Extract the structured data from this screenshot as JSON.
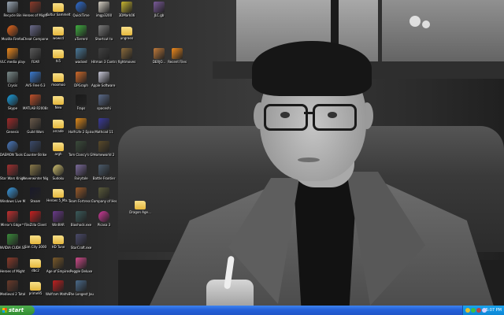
{
  "desktop": {
    "icons": [
      {
        "label": "Recycle Bin",
        "icon": "recycle-bin-icon",
        "color": "#9aa7b4",
        "shape": "sq"
      },
      {
        "label": "Heroes of Might and...",
        "icon": "game-icon",
        "color": "#8a3a2a",
        "shape": "sq"
      },
      {
        "label": "Kultur Sammelt",
        "icon": "folder-icon",
        "color": "",
        "shape": "folder"
      },
      {
        "label": "QuickTime",
        "icon": "quicktime-icon",
        "color": "#2f6fd6",
        "shape": "round"
      },
      {
        "label": "imgp3200",
        "icon": "image-file-icon",
        "color": "#d6d0c4",
        "shape": "sq"
      },
      {
        "label": "3DMark06",
        "icon": "benchmark-icon",
        "color": "#c8b530",
        "shape": "sq"
      },
      {
        "label": "Mozilla Firefox",
        "icon": "firefox-icon",
        "color": "#e8671c",
        "shape": "round"
      },
      {
        "label": "Cheat Component",
        "icon": "component-icon",
        "color": "#6a6a8a",
        "shape": "sq"
      },
      {
        "label": "wowcd",
        "icon": "folder-icon",
        "color": "",
        "shape": "folder"
      },
      {
        "label": "uTorrent",
        "icon": "utorrent-icon",
        "color": "#3fae3f",
        "shape": "sq"
      },
      {
        "label": "Shortcut to",
        "icon": "shortcut-icon",
        "color": "#7a7a7a",
        "shape": "sq"
      },
      {
        "label": "ungreen",
        "icon": "folder-icon",
        "color": "",
        "shape": "folder"
      },
      {
        "label": "VLC media player",
        "icon": "vlc-icon",
        "color": "#f08a1c",
        "shape": "sq"
      },
      {
        "label": "FEAR",
        "icon": "game-icon",
        "color": "#5a5a5a",
        "shape": "sq"
      },
      {
        "label": "hi5",
        "icon": "folder-icon",
        "color": "",
        "shape": "folder"
      },
      {
        "label": "wacked",
        "icon": "app-icon",
        "color": "#4a7a9a",
        "shape": "sq"
      },
      {
        "label": "Hitman 3 Contracts",
        "icon": "game-icon",
        "color": "#404040",
        "shape": "sq"
      },
      {
        "label": "fightmoves",
        "icon": "game-icon",
        "color": "#8a6a3a",
        "shape": "sq"
      },
      {
        "label": "Crysis",
        "icon": "crysis-icon",
        "color": "#7a8a8a",
        "shape": "sq"
      },
      {
        "label": "AVS Free 6.3",
        "icon": "avs-icon",
        "color": "#3a7ad0",
        "shape": "sq"
      },
      {
        "label": "moomoo",
        "icon": "folder-icon",
        "color": "",
        "shape": "folder"
      },
      {
        "label": "DPGraph",
        "icon": "graph-icon",
        "color": "#d06a2a",
        "shape": "sq"
      },
      {
        "label": "Apple Software Up",
        "icon": "apple-update-icon",
        "color": "#c8c8d8",
        "shape": "sq"
      },
      {
        "label": "Skype",
        "icon": "skype-icon",
        "color": "#1aa0e0",
        "shape": "round"
      },
      {
        "label": "MATLAB R2008a",
        "icon": "matlab-icon",
        "color": "#c0502a",
        "shape": "sq"
      },
      {
        "label": "New",
        "icon": "folder-icon",
        "color": "",
        "shape": "folder"
      },
      {
        "label": "Fraps",
        "icon": "fraps-icon",
        "color": "#1a1a1a",
        "shape": "sq"
      },
      {
        "label": "spaceshi",
        "icon": "app-icon",
        "color": "#5a6a8a",
        "shape": "sq"
      },
      {
        "label": "Genesis",
        "icon": "game-icon",
        "color": "#a02a2a",
        "shape": "sq"
      },
      {
        "label": "Guild Wars",
        "icon": "game-icon",
        "color": "#6a5a4a",
        "shape": "sq"
      },
      {
        "label": "arcade",
        "icon": "folder-icon",
        "color": "",
        "shape": "folder"
      },
      {
        "label": "Half-Life 2 Episode One",
        "icon": "half-life-icon",
        "color": "#e08a1a",
        "shape": "sq"
      },
      {
        "label": "Mathcad 11",
        "icon": "mathcad-icon",
        "color": "#3a3a9a",
        "shape": "sq"
      },
      {
        "label": "DAEMON Tools Lite",
        "icon": "daemon-tools-icon",
        "color": "#4a7ac0",
        "shape": "round"
      },
      {
        "label": "Counter-Strike",
        "icon": "counter-strike-icon",
        "color": "#3a4a6a",
        "shape": "sq"
      },
      {
        "label": "argh",
        "icon": "folder-icon",
        "color": "",
        "shape": "folder"
      },
      {
        "label": "Tom Clancy's Ghost Recon",
        "icon": "game-icon",
        "color": "#3a4a3a",
        "shape": "sq"
      },
      {
        "label": "Homeworld 2",
        "icon": "game-icon",
        "color": "#5a4a2a",
        "shape": "sq"
      },
      {
        "label": "Star Wars Knights of t...",
        "icon": "star-wars-icon",
        "color": "#a03030",
        "shape": "sq"
      },
      {
        "label": "Neverwinter Nights 2",
        "icon": "game-icon",
        "color": "#8a7a4a",
        "shape": "sq"
      },
      {
        "label": "Sudoku",
        "icon": "sudoku-icon",
        "color": "#d0c070",
        "shape": "round"
      },
      {
        "label": "Fairytale",
        "icon": "game-icon",
        "color": "#7a6a9a",
        "shape": "sq"
      },
      {
        "label": "Battle Frontier",
        "icon": "game-icon",
        "color": "#4a5a6a",
        "shape": "sq"
      },
      {
        "label": "Windows Live Messenger",
        "icon": "messenger-icon",
        "color": "#3a9ae0",
        "shape": "round"
      },
      {
        "label": "Steam",
        "icon": "steam-icon",
        "color": "#1a1a2a",
        "shape": "sq"
      },
      {
        "label": "Heroes 5_Ma...",
        "icon": "folder-icon",
        "color": "",
        "shape": "folder"
      },
      {
        "label": "Team Fortress 2",
        "icon": "team-fortress-icon",
        "color": "#9a5a2a",
        "shape": "sq"
      },
      {
        "label": "Company of Heroes",
        "icon": "game-icon",
        "color": "#5a5a3a",
        "shape": "sq"
      },
      {
        "label": "Mirror's Edge™",
        "icon": "game-icon",
        "color": "#c03030",
        "shape": "sq"
      },
      {
        "label": "FileZilla Client",
        "icon": "filezilla-icon",
        "color": "#c82020",
        "shape": "sq"
      },
      {
        "label": "WinRAR",
        "icon": "winrar-icon",
        "color": "#6a3a8a",
        "shape": "sq"
      },
      {
        "label": "Bioshock.exe",
        "icon": "game-icon",
        "color": "#3a5a5a",
        "shape": "sq"
      },
      {
        "label": "Picasa 3",
        "icon": "picasa-icon",
        "color": "#d03a9a",
        "shape": "round"
      },
      {
        "label": "NVIDIA CUDA SDK Browser",
        "icon": "nvidia-icon",
        "color": "#3a8a3a",
        "shape": "sq"
      },
      {
        "label": "Sim City 3000",
        "icon": "folder-icon",
        "color": "",
        "shape": "folder"
      },
      {
        "label": "HD Tune",
        "icon": "folder-icon",
        "color": "",
        "shape": "folder"
      },
      {
        "label": "StarCraft.exe",
        "icon": "starcraft-icon",
        "color": "#4a4a6a",
        "shape": "sq"
      },
      {
        "label": "Heroes of Might and...",
        "icon": "game-icon",
        "color": "#8a3a2a",
        "shape": "sq"
      },
      {
        "label": "dbc2",
        "icon": "folder-icon",
        "color": "",
        "shape": "folder"
      },
      {
        "label": "Age of Empires",
        "icon": "game-icon",
        "color": "#7a5a2a",
        "shape": "sq"
      },
      {
        "label": "Peggle Deluxe",
        "icon": "peggle-icon",
        "color": "#d04a8a",
        "shape": "sq"
      },
      {
        "label": "Medieval 2 Total War",
        "icon": "game-icon",
        "color": "#6a3a2a",
        "shape": "sq"
      },
      {
        "label": "prime95",
        "icon": "folder-icon",
        "color": "",
        "shape": "folder"
      },
      {
        "label": "Wolfram Mathematica 7",
        "icon": "mathematica-icon",
        "color": "#c02020",
        "shape": "sq"
      },
      {
        "label": "The Longest Journey",
        "icon": "game-icon",
        "color": "#4a6a8a",
        "shape": "sq"
      },
      {
        "label": "JLC.gb",
        "icon": "file-icon",
        "color": "#7a5a9a",
        "shape": "sq"
      },
      {
        "label": "DERJO...",
        "icon": "file-icon",
        "color": "#c07a3a",
        "shape": "sq"
      },
      {
        "label": "Recent Files",
        "icon": "vlc-icon",
        "color": "#f08a1c",
        "shape": "sq"
      },
      {
        "label": "Dragon Age...",
        "icon": "folder-icon",
        "color": "",
        "shape": "folder"
      }
    ]
  },
  "taskbar": {
    "start_label": "start",
    "clock": "5:07 PM",
    "tray_colors": [
      "#e0c030",
      "#40c040",
      "#c04040",
      "#d0d0ff"
    ]
  }
}
